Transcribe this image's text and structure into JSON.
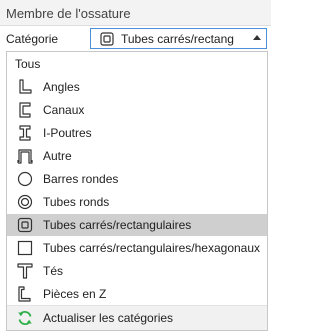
{
  "panel": {
    "title": "Membre de l'ossature"
  },
  "category": {
    "label": "Catégorie",
    "selected_value": "Tubes carrés/rectang",
    "selected_icon": "square-tube-icon"
  },
  "dropdown": {
    "all_label": "Tous",
    "items": [
      {
        "label": "Angles",
        "icon": "angle-icon"
      },
      {
        "label": "Canaux",
        "icon": "channel-icon"
      },
      {
        "label": "I-Poutres",
        "icon": "i-beam-icon"
      },
      {
        "label": "Autre",
        "icon": "other-profile-icon"
      },
      {
        "label": "Barres rondes",
        "icon": "round-bar-icon"
      },
      {
        "label": "Tubes ronds",
        "icon": "round-tube-icon"
      },
      {
        "label": "Tubes carrés/rectangulaires",
        "icon": "square-tube-icon",
        "selected": true
      },
      {
        "label": "Tubes carrés/rectangulaires/hexagonaux",
        "icon": "rect-tube-icon"
      },
      {
        "label": "Tés",
        "icon": "tee-icon"
      },
      {
        "label": "Pièces en Z",
        "icon": "z-section-icon"
      }
    ],
    "refresh_label": "Actualiser les catégories",
    "refresh_icon": "refresh-icon"
  },
  "colors": {
    "selected_row": "#cfcfcf",
    "combo_border": "#4b8fd8",
    "refresh_icon": "#2fb14a"
  }
}
